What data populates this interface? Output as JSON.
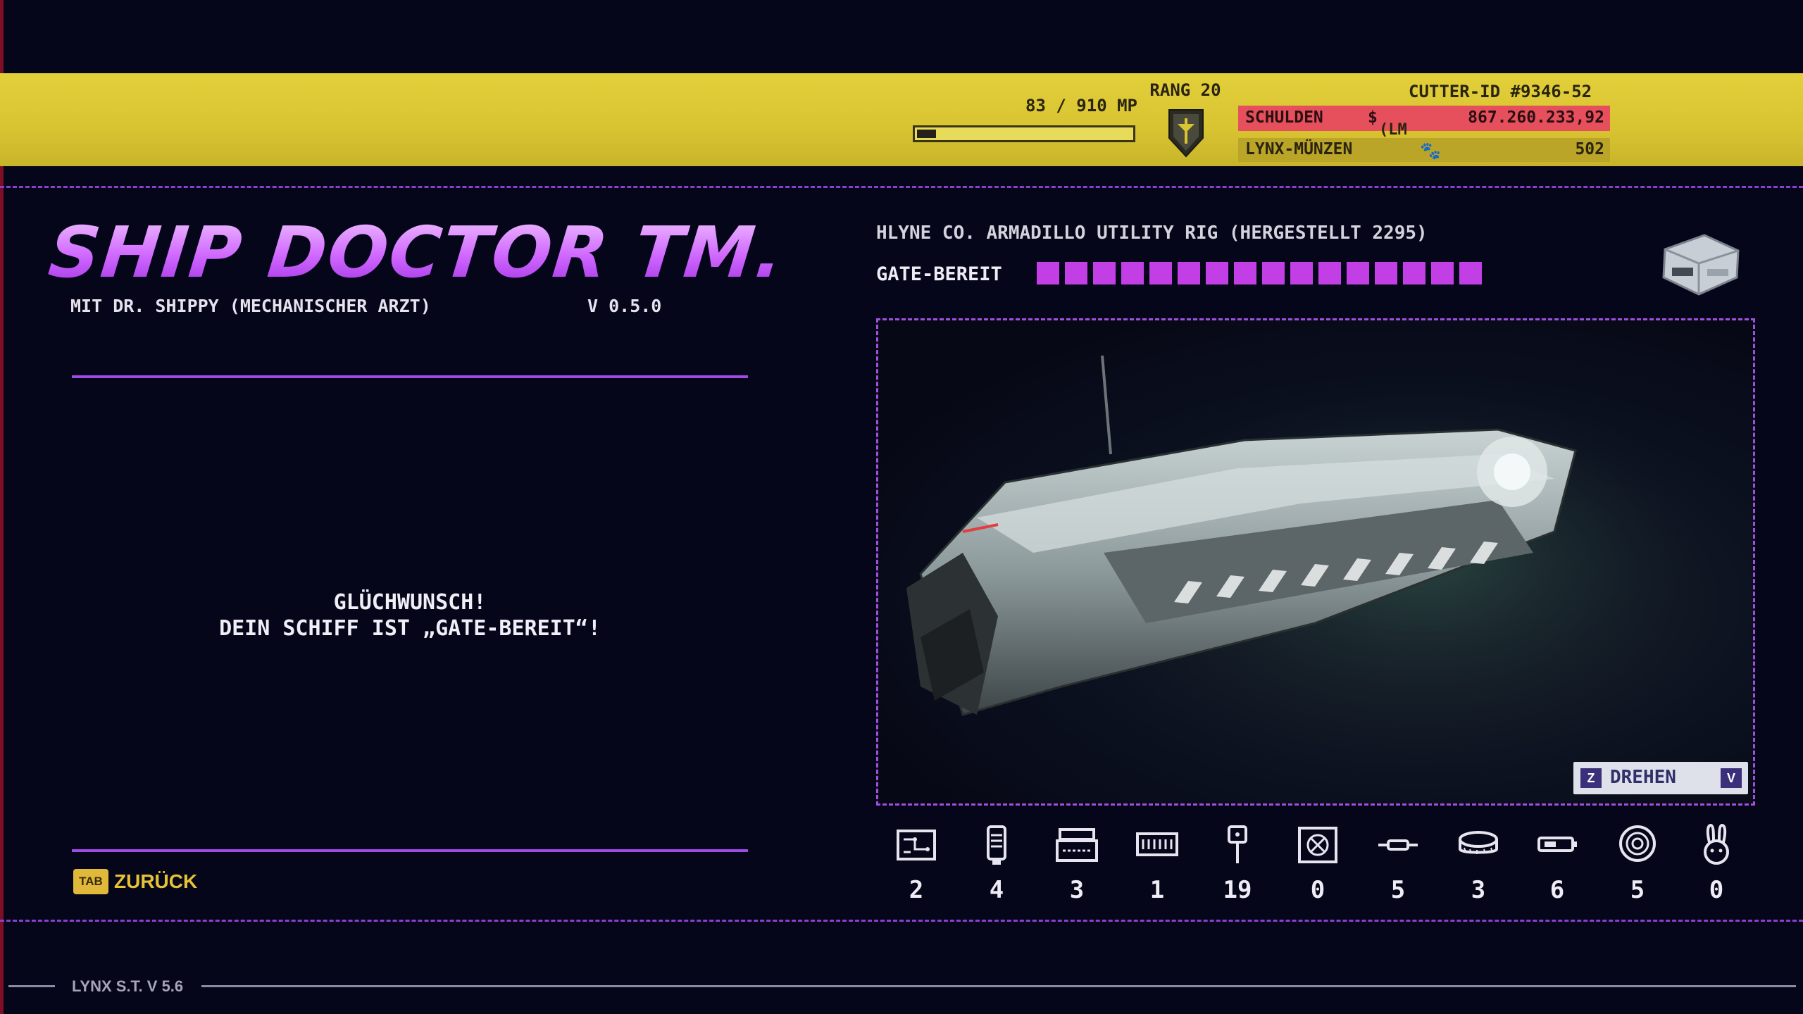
{
  "header": {
    "mp_text": "83 / 910 MP",
    "mp_progress": 0.09,
    "rank_text": "RANG 20",
    "cutter_id": "CUTTER-ID  #9346-52",
    "debt_label": "SCHULDEN",
    "debt_currency": "$",
    "debt_sub": "(LM",
    "debt_value": "867.260.233,92",
    "coins_label": "LYNX-MÜNZEN",
    "coins_icon": "paw-icon",
    "coins_value": "502",
    "colors": {
      "bar": "#d8c431",
      "debt": "#e6505c"
    }
  },
  "left": {
    "title": "SHIP DOCTOR TM.",
    "subtitle": "MIT DR. SHIPPY (MECHANISCHER ARZT)",
    "version": "V 0.5.0",
    "message_line1": "GLÜCHWUNSCH!",
    "message_line2": "DEIN SCHIFF IST „GATE-BEREIT“!",
    "back_key": "TAB",
    "back_label": "ZURÜCK"
  },
  "right": {
    "ship_name": "HLYNE CO. ARMADILLO UTILITY RIG (HERGESTELLT 2295)",
    "gate_label": "GATE-BEREIT",
    "gate_segments_filled": 16,
    "gate_segments_total": 16,
    "rotate_key_left": "Z",
    "rotate_label": "DREHEN",
    "rotate_key_right": "V",
    "accent": "#c23fe6"
  },
  "inventory": [
    {
      "icon": "circuit-board-icon",
      "count": "2"
    },
    {
      "icon": "canister-icon",
      "count": "4"
    },
    {
      "icon": "machine-block-icon",
      "count": "3"
    },
    {
      "icon": "memory-module-icon",
      "count": "1"
    },
    {
      "icon": "sign-post-icon",
      "count": "19"
    },
    {
      "icon": "fan-unit-icon",
      "count": "0"
    },
    {
      "icon": "fuse-icon",
      "count": "5"
    },
    {
      "icon": "coil-disc-icon",
      "count": "3"
    },
    {
      "icon": "battery-cell-icon",
      "count": "6"
    },
    {
      "icon": "cable-reel-icon",
      "count": "5"
    },
    {
      "icon": "bunny-icon",
      "count": "0"
    }
  ],
  "footer": {
    "label": "LYNX S.T. V 5.6"
  }
}
